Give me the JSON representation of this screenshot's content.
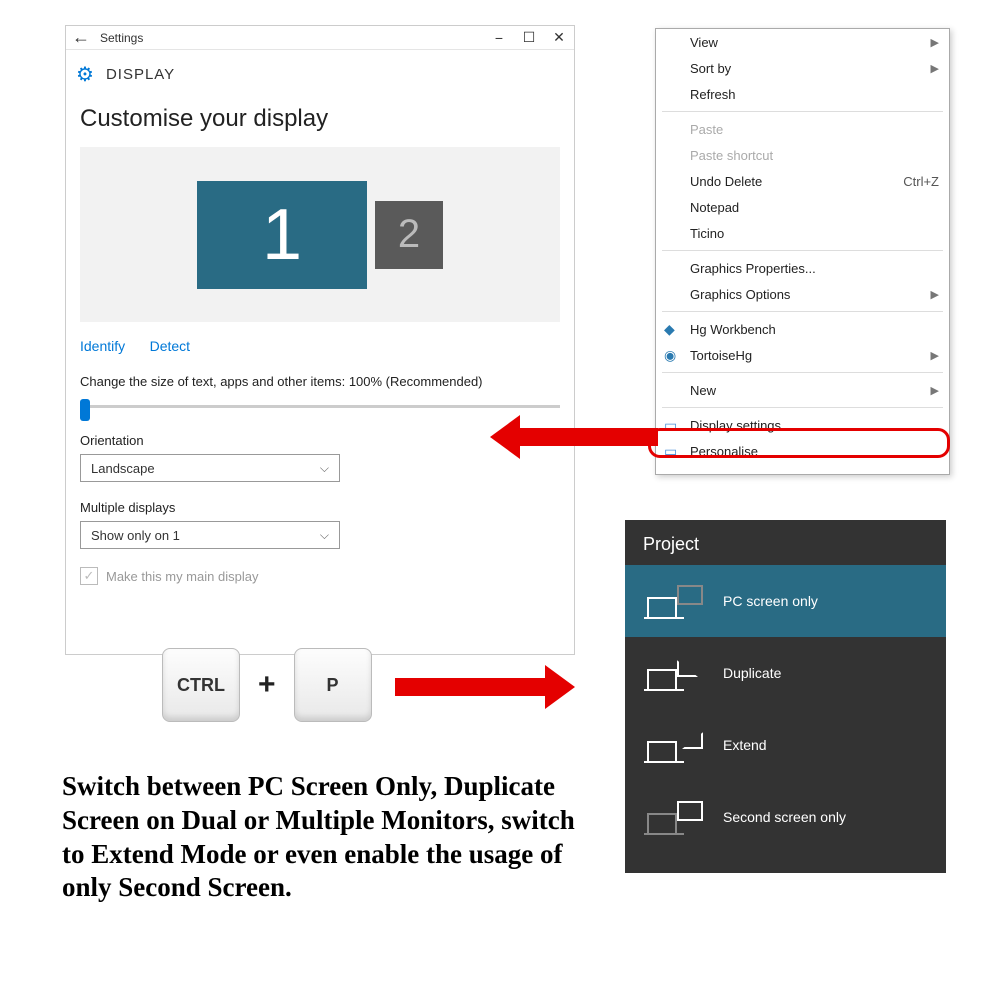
{
  "settings": {
    "titlebar": {
      "label": "Settings",
      "back": "←",
      "min": "−",
      "max": "☐",
      "close": "✕"
    },
    "header": "DISPLAY",
    "customise": "Customise your display",
    "monitor1": "1",
    "monitor2": "2",
    "identify": "Identify",
    "detect": "Detect",
    "sizeLabel": "Change the size of text, apps and other items: 100% (Recommended)",
    "orientationLabel": "Orientation",
    "orientationValue": "Landscape",
    "multiLabel": "Multiple displays",
    "multiValue": "Show only on 1",
    "mainChk": "Make this my main display"
  },
  "ctx": {
    "items": [
      {
        "label": "View",
        "arrow": true
      },
      {
        "label": "Sort by",
        "arrow": true
      },
      {
        "label": "Refresh"
      },
      {
        "sep": true
      },
      {
        "label": "Paste",
        "disabled": true
      },
      {
        "label": "Paste shortcut",
        "disabled": true
      },
      {
        "label": "Undo Delete",
        "shortcut": "Ctrl+Z"
      },
      {
        "label": "Notepad"
      },
      {
        "label": "Ticino"
      },
      {
        "sep": true
      },
      {
        "label": "Graphics Properties..."
      },
      {
        "label": "Graphics Options",
        "arrow": true
      },
      {
        "sep": true
      },
      {
        "label": "Hg Workbench",
        "icon": "tiny-icon-blue",
        "iconGlyph": "◆"
      },
      {
        "label": "TortoiseHg",
        "icon": "tiny-icon-blue",
        "iconGlyph": "◉",
        "arrow": true
      },
      {
        "sep": true
      },
      {
        "label": "New",
        "arrow": true
      },
      {
        "sep": true
      },
      {
        "label": "Display settings",
        "icon": "tiny-icon-mon",
        "iconGlyph": "▭",
        "highlight": true
      },
      {
        "label": "Personalise",
        "icon": "tiny-icon-mon",
        "iconGlyph": "▭"
      }
    ]
  },
  "keys": {
    "k1": "CTRL",
    "plus": "+",
    "k2": "P"
  },
  "caption": "Switch between PC Screen Only, Duplicate Screen on Dual or Multiple Monitors, switch to Extend Mode or even enable the usage of only Second Screen.",
  "project": {
    "title": "Project",
    "items": [
      {
        "label": "PC screen only",
        "selected": true
      },
      {
        "label": "Duplicate"
      },
      {
        "label": "Extend"
      },
      {
        "label": "Second screen only"
      }
    ]
  }
}
